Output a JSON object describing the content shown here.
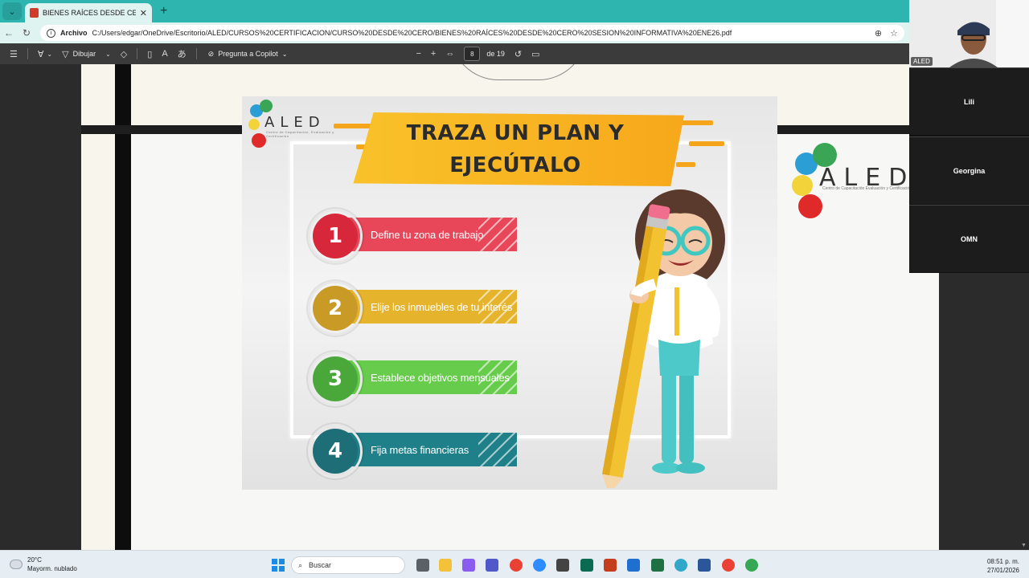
{
  "browser": {
    "tab_title": "BIENES RAÍCES DESDE CERO SESIÓ",
    "tab_close": "✕",
    "new_tab": "+",
    "url_label": "Archivo",
    "url": "C:/Users/edgar/OneDrive/Escritorio/ALED/CURSOS%20CERTIFICACION/CURSO%20DESDE%20CERO/BIENES%20RAÍCES%20DESDE%20CERO%20SESION%20INFORMATIVA%20ENE26.pdf"
  },
  "pdf_toolbar": {
    "draw_label": "Dibujar",
    "copilot_label": "Pregunta a Copilot",
    "page_current": "8",
    "page_total": "de 19"
  },
  "slide": {
    "title_line1": "TRAZA UN PLAN Y",
    "title_line2": "EJECÚTALO",
    "logo": "ALED",
    "logo_sub": "Centro de Capacitación, Evaluación y Certificación",
    "steps": [
      {
        "num": "1",
        "label": "Define tu zona de trabajo",
        "color": "#d6283a",
        "bar": "#e8475a"
      },
      {
        "num": "2",
        "label": "Elije los inmuebles de tu interés",
        "color": "#c99a26",
        "bar": "#e6b32c"
      },
      {
        "num": "3",
        "label": "Establece objetivos mensuales",
        "color": "#4aa83a",
        "bar": "#67cc4c"
      },
      {
        "num": "4",
        "label": "Fija metas financieras",
        "color": "#1e6e78",
        "bar": "#1f8089"
      }
    ]
  },
  "page_logo": {
    "text": "ALED",
    "sub": "Centro de Capacitación Evaluación y Certificación"
  },
  "meeting": {
    "self_tag": "ALED",
    "participants": [
      "Lili",
      "Georgina",
      "OMN"
    ]
  },
  "taskbar": {
    "temperature": "20°C",
    "weather": "Mayorm. nublado",
    "search": "Buscar",
    "time": "08:51 p. m.",
    "date": "27/01/2026"
  }
}
